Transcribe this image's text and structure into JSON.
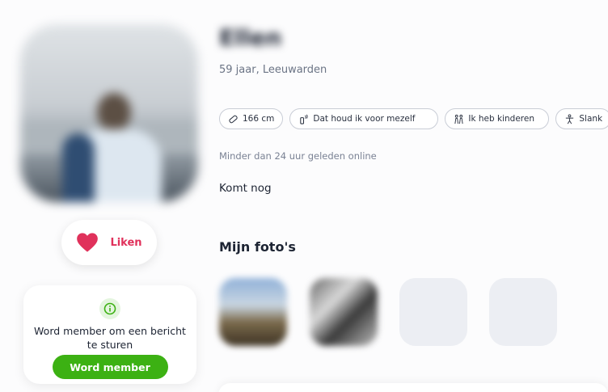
{
  "profile": {
    "name": "Ellen",
    "age_city": "59 jaar, Leeuwarden",
    "tags": [
      {
        "icon": "ruler-icon",
        "label": "166 cm"
      },
      {
        "icon": "smoking-icon",
        "label": "Dat houd ik voor mezelf"
      },
      {
        "icon": "kids-icon",
        "label": "Ik heb kinderen"
      },
      {
        "icon": "body-icon",
        "label": "Slank"
      }
    ],
    "online_status": "Minder dan 24 uur geleden online",
    "about": "Komt nog"
  },
  "actions": {
    "like_label": "Liken"
  },
  "member_card": {
    "message": "Word member om een bericht te sturen",
    "button_label": "Word member"
  },
  "photos": {
    "title": "Mijn foto's"
  },
  "colors": {
    "accent_pink": "#e0315b",
    "accent_green": "#3cb113",
    "text_dark": "#1d2433",
    "text_muted": "#6b7485"
  }
}
